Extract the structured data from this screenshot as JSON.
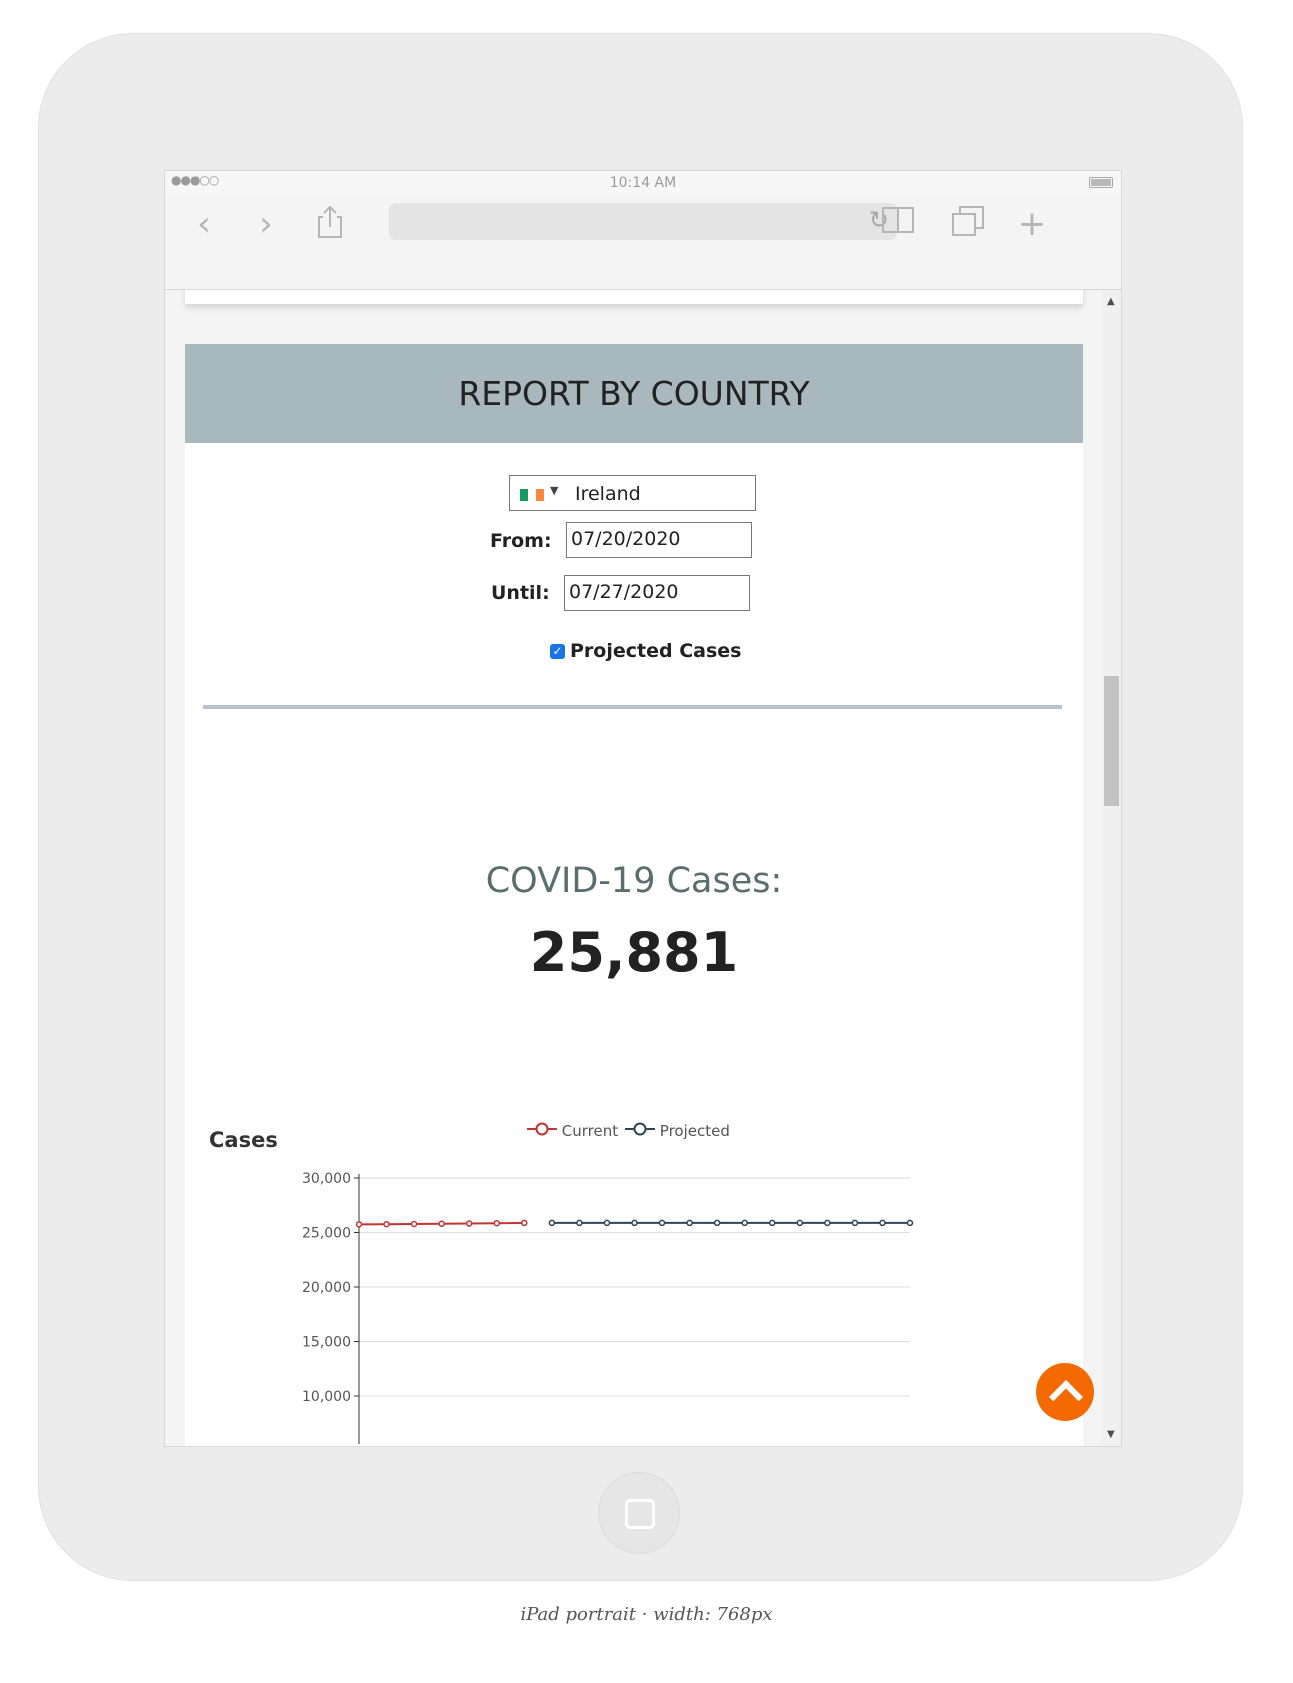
{
  "device": {
    "clock": "10:14 AM",
    "caption": "iPad portrait · width: 768px",
    "signal": "●●●○○"
  },
  "report": {
    "title": "REPORT BY COUNTRY",
    "country": "Ireland",
    "flag_colors": [
      "#169b62",
      "#ffffff",
      "#ff883e"
    ],
    "from_label": "From:",
    "from_value": "07/20/2020",
    "until_label": "Until:",
    "until_value": "07/27/2020",
    "projected_label": "Projected Cases",
    "projected_checked": true,
    "cases_heading": "COVID-19 Cases:",
    "cases_value": "25,881"
  },
  "chart_data": {
    "type": "line",
    "title": "Cases",
    "ylim": [
      10000,
      30000
    ],
    "yticks": [
      "30,000",
      "25,000",
      "20,000",
      "15,000",
      "10,000"
    ],
    "grid": true,
    "legend_position": "top-center",
    "series": [
      {
        "name": "Current",
        "color": "#c23531",
        "x": [
          0,
          1,
          2,
          3,
          4,
          5,
          6
        ],
        "values": [
          25750,
          25760,
          25780,
          25800,
          25820,
          25850,
          25881
        ]
      },
      {
        "name": "Projected",
        "color": "#2f4554",
        "x": [
          7,
          8,
          9,
          10,
          11,
          12,
          13,
          14,
          15,
          16,
          17,
          18,
          19,
          20
        ],
        "values": [
          25881,
          25881,
          25881,
          25881,
          25881,
          25881,
          25881,
          25881,
          25881,
          25881,
          25881,
          25881,
          25881,
          25881
        ]
      }
    ]
  },
  "accent": "#f56a00"
}
